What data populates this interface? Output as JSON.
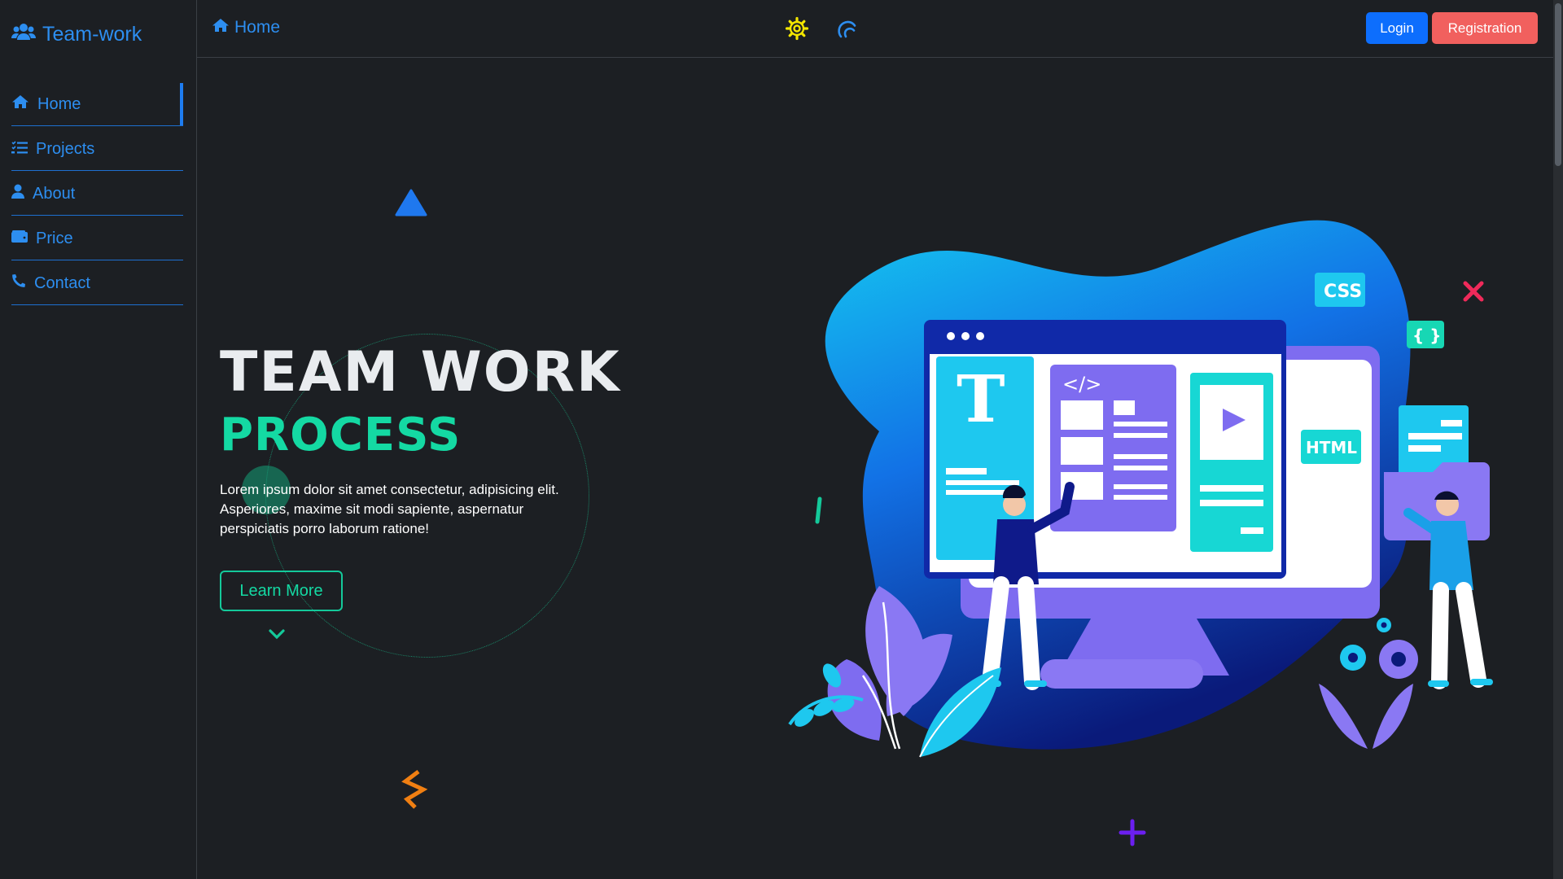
{
  "brand": {
    "name": "Team-work",
    "icon": "users-icon",
    "color": "#2d8ef0"
  },
  "sidebar": {
    "items": [
      {
        "label": "Home",
        "icon": "home-icon",
        "active": true
      },
      {
        "label": "Projects",
        "icon": "list-icon",
        "active": false
      },
      {
        "label": "About",
        "icon": "user-icon",
        "active": false
      },
      {
        "label": "Price",
        "icon": "wallet-icon",
        "active": false
      },
      {
        "label": "Contact",
        "icon": "phone-icon",
        "active": false
      }
    ]
  },
  "topbar": {
    "breadcrumb": "Home",
    "theme_icon": "gear-icon",
    "refresh_icon": "refresh-icon",
    "login_label": "Login",
    "register_label": "Registration"
  },
  "hero": {
    "title": "TEAM WORK",
    "subtitle": "PROCESS",
    "text": "Lorem ipsum dolor sit amet consectetur, adipisicing elit. Asperiores, maxime sit modi sapiente, aspernatur perspiciatis porro laborum ratione!",
    "cta_label": "Learn More"
  },
  "illustration": {
    "labels": {
      "css": "CSS",
      "braces": "{ }",
      "html": "HTML",
      "code": "</>",
      "letter": "T"
    }
  },
  "colors": {
    "accent": "#14d9a3",
    "primary": "#0d6efd",
    "danger": "#f1605e",
    "background": "#1c1f23"
  }
}
